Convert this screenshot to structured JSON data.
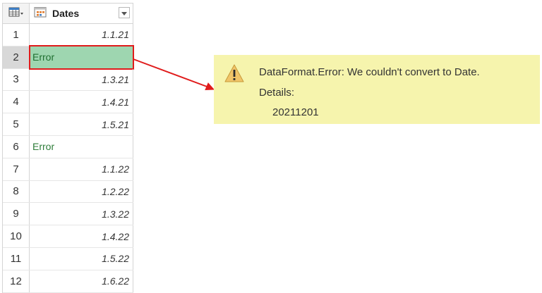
{
  "table": {
    "column_header": "Dates",
    "rows": [
      {
        "num": "1",
        "value": "1.1.21"
      },
      {
        "num": "2",
        "value": "Error"
      },
      {
        "num": "3",
        "value": "1.3.21"
      },
      {
        "num": "4",
        "value": "1.4.21"
      },
      {
        "num": "5",
        "value": "1.5.21"
      },
      {
        "num": "6",
        "value": "Error"
      },
      {
        "num": "7",
        "value": "1.1.22"
      },
      {
        "num": "8",
        "value": "1.2.22"
      },
      {
        "num": "9",
        "value": "1.3.22"
      },
      {
        "num": "10",
        "value": "1.4.22"
      },
      {
        "num": "11",
        "value": "1.5.22"
      },
      {
        "num": "12",
        "value": "1.6.22"
      }
    ]
  },
  "tooltip": {
    "message": "DataFormat.Error: We couldn't convert to Date.",
    "details_label": "Details:",
    "details_value": "20211201"
  },
  "colors": {
    "selection_border": "#e01b1b",
    "error_text": "#2e7d3a",
    "selected_fill": "#9ed6b0",
    "tooltip_bg": "#f6f4ad"
  }
}
